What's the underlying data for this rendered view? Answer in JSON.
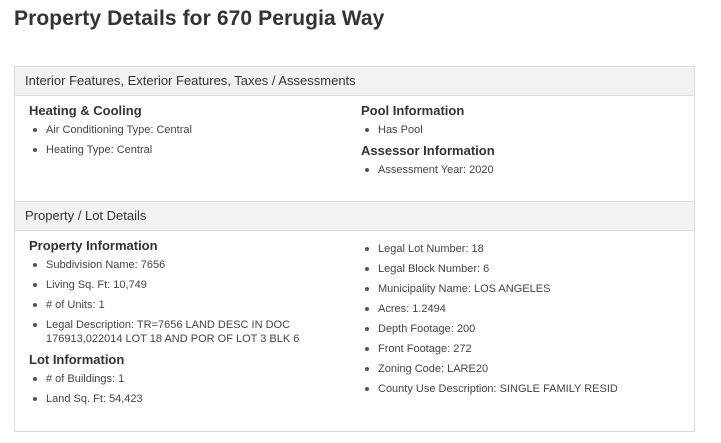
{
  "page": {
    "title": "Property Details for 670 Perugia Way"
  },
  "interior_panel": {
    "header": "Interior Features, Exterior Features, Taxes / Assessments",
    "heating_cooling": {
      "title": "Heating & Cooling",
      "items": [
        "Air Conditioning Type: Central",
        "Heating Type: Central"
      ]
    },
    "pool": {
      "title": "Pool Information",
      "items": [
        "Has Pool"
      ]
    },
    "assessor": {
      "title": "Assessor Information",
      "items": [
        "Assessment Year: 2020"
      ]
    }
  },
  "lot_panel": {
    "header": "Property / Lot Details",
    "property_info": {
      "title": "Property Information",
      "items": [
        "Subdivision Name: 7656",
        "Living Sq. Ft: 10,749",
        "# of Units: 1",
        "Legal Description: TR=7656 LAND DESC IN DOC 176913,022014 LOT 18 AND POR OF LOT 3 BLK 6"
      ]
    },
    "lot_info": {
      "title": "Lot Information",
      "items": [
        "# of Buildings: 1",
        "Land Sq. Ft: 54,423"
      ]
    },
    "right_items": [
      "Legal Lot Number: 18",
      "Legal Block Number: 6",
      "Municipality Name: LOS ANGELES",
      "Acres: 1.2494",
      "Depth Footage: 200",
      "Front Footage: 272",
      "Zoning Code: LARE20",
      "County Use Description: SINGLE FAMILY RESID"
    ]
  }
}
